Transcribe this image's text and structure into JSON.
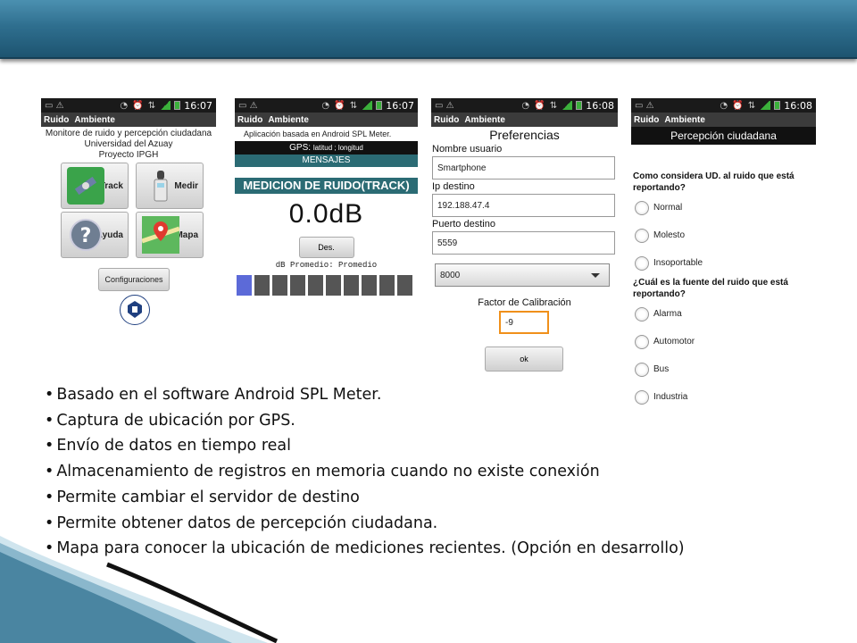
{
  "phones": {
    "common": {
      "action_bar": {
        "app": "Ruido",
        "menu": "Ambiente"
      }
    },
    "p1": {
      "status_time": "16:07",
      "header_lines": [
        "Monitore de ruido y percepción ciudadana",
        "Universidad del Azuay",
        "Proyecto IPGH"
      ],
      "tiles": [
        "Track",
        "Medir",
        "Ayuda",
        "Mapa"
      ],
      "config_button": "Configuraciones"
    },
    "p2": {
      "status_time": "16:07",
      "subtitle": "Aplicación basada en Android SPL Meter.",
      "gps_label": "GPS:",
      "gps_value": "latitud ; longitud",
      "messages": "MENSAJES",
      "measurement_title": "MEDICION DE RUIDO(TRACK)",
      "db_value": "0.0dB",
      "des_button": "Des.",
      "average_label": "dB Promedio: Promedio",
      "level_cells": 10,
      "level_active": 1
    },
    "p3": {
      "status_time": "16:08",
      "title": "Preferencias",
      "user_label": "Nombre usuario",
      "user_value": "Smartphone",
      "ip_label": "Ip destino",
      "ip_value": "192.188.47.4",
      "port_label": "Puerto destino",
      "port_value": "5559",
      "rate_value": "8000",
      "calibration_label": "Factor de Calibración",
      "calibration_value": "-9",
      "ok_button": "ok"
    },
    "p4": {
      "status_time": "16:08",
      "title": "Percepción ciudadana",
      "question1": "Como considera UD. al ruido que está reportando?",
      "options1": [
        "Normal",
        "Molesto",
        "Insoportable"
      ],
      "question2": "¿Cuál es la fuente del ruido que está reportando?",
      "options2": [
        "Alarma",
        "Automotor",
        "Bus",
        "Industria"
      ]
    }
  },
  "bullets": [
    "Basado en el software Android SPL Meter.",
    "Captura de ubicación por GPS.",
    "Envío de datos en tiempo real",
    "Almacenamiento de registros en memoria cuando no existe conexión",
    "Permite cambiar el servidor de destino",
    "Permite obtener datos de percepción ciudadana.",
    "Mapa para conocer la ubicación de mediciones recientes. (Opción en desarrollo)"
  ],
  "colors": {
    "banner": "#2f6f8f",
    "teal_bar": "#2b6b74",
    "level_active": "#5c6ad8",
    "calibration_border": "#f0901a"
  }
}
